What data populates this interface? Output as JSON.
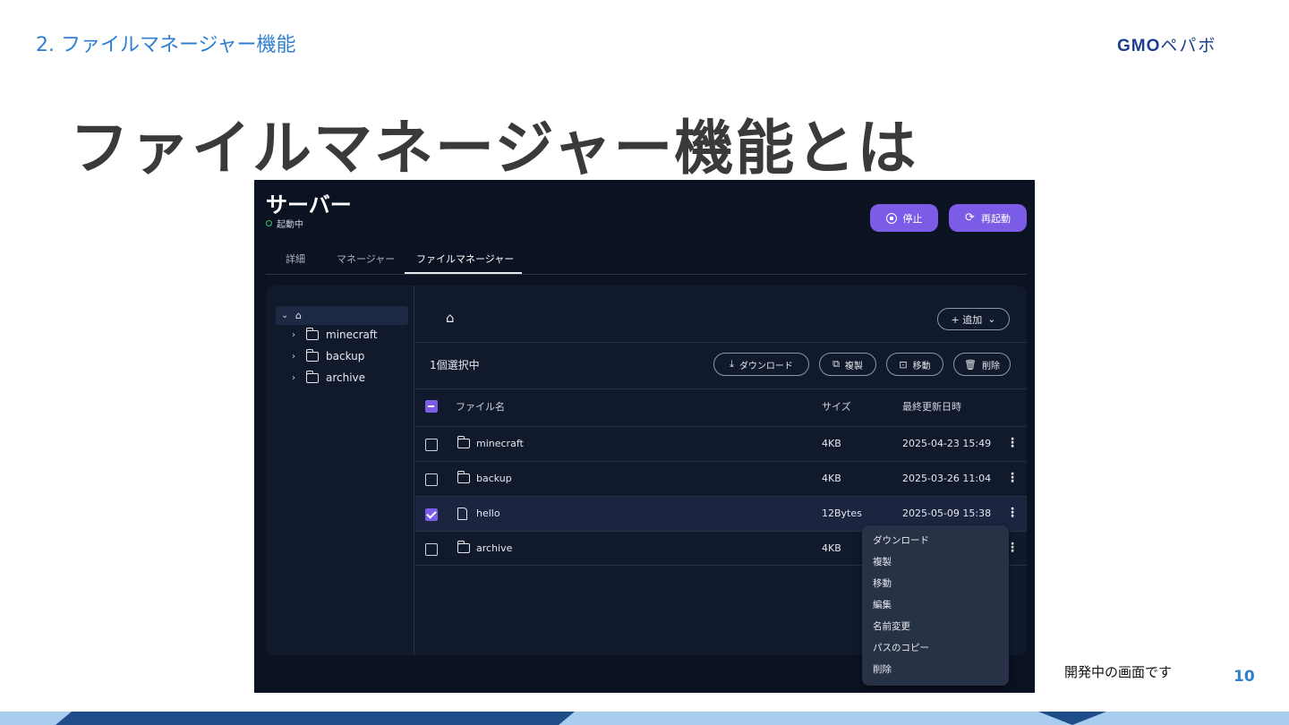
{
  "slide": {
    "section_title": "2. ファイルマネージャー機能",
    "logo_text": "GMO",
    "logo_kana": "ペパボ",
    "title": "ファイルマネージャー機能とは",
    "caption": "開発中の画面です",
    "page_number": "10"
  },
  "app": {
    "server_title": "サーバー",
    "status": "起動中",
    "stop_label": "停止",
    "restart_label": "再起動",
    "tabs": [
      {
        "label": "詳細"
      },
      {
        "label": "マネージャー"
      },
      {
        "label": "ファイルマネージャー",
        "active": true
      }
    ],
    "tree": {
      "items": [
        {
          "label": "minecraft"
        },
        {
          "label": "backup"
        },
        {
          "label": "archive"
        }
      ]
    },
    "toolbar": {
      "add_label": "+ 追加",
      "selection_text": "1個選択中",
      "download_label": "ダウンロード",
      "copy_label": "複製",
      "move_label": "移動",
      "delete_label": "削除"
    },
    "table": {
      "headers": {
        "name": "ファイル名",
        "size": "サイズ",
        "date": "最終更新日時"
      },
      "rows": [
        {
          "type": "folder",
          "name": "minecraft",
          "size": "4KB",
          "date": "2025-04-23 15:49",
          "checked": false
        },
        {
          "type": "folder",
          "name": "backup",
          "size": "4KB",
          "date": "2025-03-26 11:04",
          "checked": false
        },
        {
          "type": "file",
          "name": "hello",
          "size": "12Bytes",
          "date": "2025-05-09 15:38",
          "checked": true
        },
        {
          "type": "folder",
          "name": "archive",
          "size": "4KB",
          "date": "",
          "checked": false
        }
      ]
    },
    "context_menu": {
      "items": [
        {
          "label": "ダウンロード"
        },
        {
          "label": "複製"
        },
        {
          "label": "移動"
        },
        {
          "label": "編集"
        },
        {
          "label": "名前変更"
        },
        {
          "label": "パスのコピー"
        },
        {
          "label": "削除"
        }
      ]
    },
    "colors": {
      "accent": "#7b5ce6",
      "background": "#0b1222",
      "panel": "#111a2c",
      "status_ok": "#3fbf6f"
    }
  }
}
